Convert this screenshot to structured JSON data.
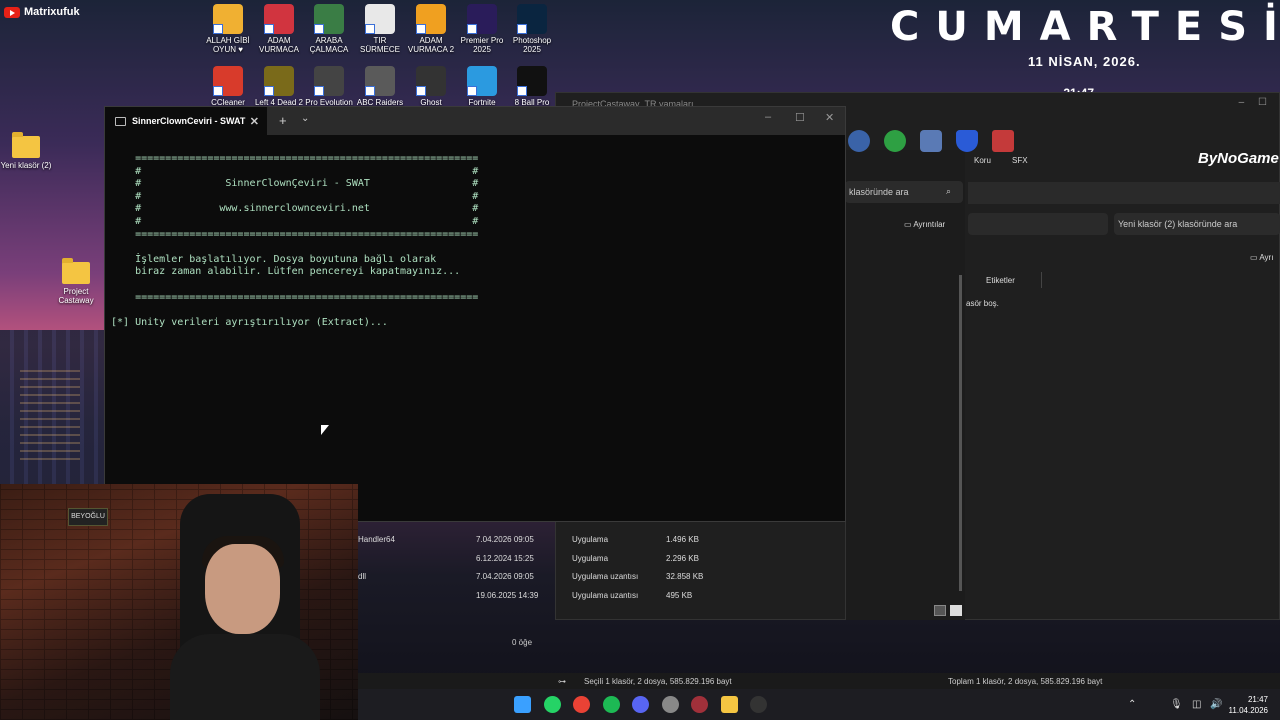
{
  "channel": {
    "name": "Matrixufuk"
  },
  "widget": {
    "day": "CUMARTESİ",
    "date": "11 NİSAN, 2026.",
    "time": "- 21:47 -"
  },
  "desktop_icons": [
    {
      "label": "ALLAH GİBİ OYUN ♥",
      "color": "#f0b032"
    },
    {
      "label": "ADAM VURMACA",
      "color": "#d1343f"
    },
    {
      "label": "ARABA ÇALMACA",
      "color": "#3a7d45"
    },
    {
      "label": "TIR SÜRMECE",
      "color": "#e8e8e8"
    },
    {
      "label": "ADAM VURMACA 2",
      "color": "#f0a020"
    },
    {
      "label": "Premier Pro 2025",
      "color": "#2a1c5a"
    },
    {
      "label": "Photoshop 2025",
      "color": "#0a2540"
    },
    {
      "label": "CCleaner",
      "color": "#d83b2b"
    },
    {
      "label": "Left 4 Dead 2",
      "color": "#7a6a1a"
    },
    {
      "label": "Pro Evolution",
      "color": "#444444"
    },
    {
      "label": "ABC Raiders",
      "color": "#5a5a5a"
    },
    {
      "label": "Ghost",
      "color": "#333333"
    },
    {
      "label": "Fortnite",
      "color": "#2b9ae0"
    },
    {
      "label": "8 Ball Pro",
      "color": "#111111"
    }
  ],
  "left_icons": [
    {
      "label": "Yeni klasör (2)"
    },
    {
      "label": "Project Castaway"
    }
  ],
  "back_window_title": "ProjectCastaway_TR yamaları",
  "explorer": {
    "search1": "klasöründe ara",
    "search2": "Yeni klasör (2) klasöründe ara",
    "details": "Ayrıntılar",
    "details2": "Ayrı",
    "tags_col": "Etiketler",
    "empty": "asör boş.",
    "toolbar": {
      "koru": "Koru",
      "sfx": "SFX",
      "brand": "ByNoGame"
    },
    "rows": [
      {
        "name": "Handler64",
        "date": "7.04.2026 09:05",
        "type": "Uygulama",
        "size": "1.496 KB"
      },
      {
        "name": "",
        "date": "6.12.2024 15:25",
        "type": "Uygulama",
        "size": "2.296 KB"
      },
      {
        "name": "dll",
        "date": "7.04.2026 09:05",
        "type": "Uygulama uzantısı",
        "size": "32.858 KB"
      },
      {
        "name": "",
        "date": "19.06.2025 14:39",
        "type": "Uygulama uzantısı",
        "size": "495 KB"
      }
    ],
    "item_count": "0 öğe"
  },
  "terminal": {
    "tab_title": "SinnerClownCeviri - SWAT",
    "new_tab": "+",
    "lines": [
      "    =========================================================",
      "    #                                                       #",
      "    #              SinnerClownÇeviri - SWAT                 #",
      "    #                                                       #",
      "    #             www.sinnerclownceviri.net                 #",
      "    #                                                       #",
      "    =========================================================",
      "",
      "    İşlemler başlatılıyor. Dosya boyutuna bağlı olarak",
      "    biraz zaman alabilir. Lütfen pencereyi kapatmayınız...",
      "",
      "    =========================================================",
      "",
      "[*] Unity verileri ayrıştırılıyor (Extract)..."
    ]
  },
  "statusbar": {
    "left": "Seçili 1 klasör, 2 dosya, 585.829.196 bayt",
    "right": "Toplam 1 klasör, 2 dosya, 585.829.196 bayt"
  },
  "webcam": {
    "sign": "BEYOĞLU"
  },
  "taskbar": {
    "time": "21:47",
    "date": "11.04.2026",
    "apps": [
      {
        "name": "start",
        "color": "#3aa0ff"
      },
      {
        "name": "whatsapp",
        "color": "#25d366"
      },
      {
        "name": "chrome",
        "color": "#e94235"
      },
      {
        "name": "spotify",
        "color": "#1db954"
      },
      {
        "name": "discord",
        "color": "#5865f2"
      },
      {
        "name": "obs",
        "color": "#888888"
      },
      {
        "name": "winrar",
        "color": "#a0303a"
      },
      {
        "name": "explorer",
        "color": "#f4c542"
      },
      {
        "name": "terminal",
        "color": "#333333"
      }
    ]
  }
}
